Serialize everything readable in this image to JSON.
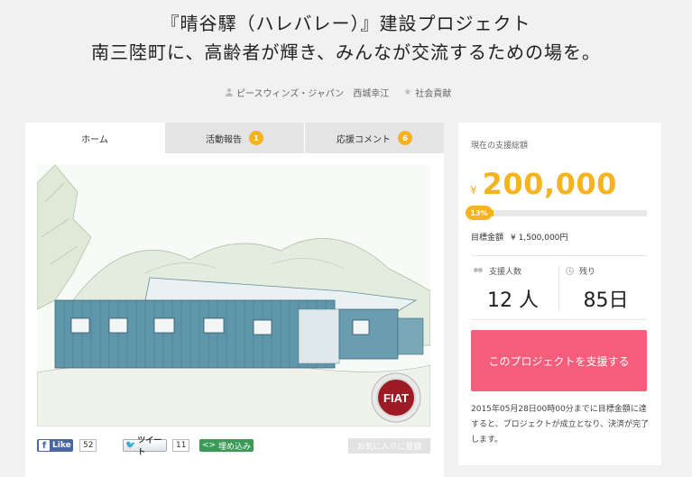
{
  "header": {
    "title": "『晴谷驛（ハレバレー）』建設プロジェクト",
    "subtitle": "南三陸町に、高齢者が輝き、みんなが交流するための場を。",
    "owner": "ピースウィンズ・ジャパン　西城幸江",
    "category": "社会貢献"
  },
  "tabs": [
    {
      "label": "ホーム",
      "badge": ""
    },
    {
      "label": "活動報告",
      "badge": "1"
    },
    {
      "label": "応援コメント",
      "badge": "6"
    }
  ],
  "hero": {
    "logo_text": "FIAT"
  },
  "social": {
    "like_label": "Like",
    "like_count": "52",
    "tweet_label": "ツイート",
    "tweet_count": "11",
    "embed_label": "埋め込み",
    "favorite_label": "お気に入りに登録"
  },
  "funding": {
    "total_label": "現在の支援総額",
    "currency": "¥",
    "amount": "200,000",
    "percent_label": "13%",
    "progress": 0.13,
    "goal_label": "目標金額",
    "goal_value": "¥ 1,500,000円",
    "supporters_label": "支援人数",
    "supporters_value": "12 人",
    "remaining_label": "残り",
    "remaining_value": "85日",
    "support_button": "このプロジェクトを支援する",
    "note": "2015年05月28日00時00分までに目標金額に達すると、プロジェクトが成立となり、決済が完了します。"
  },
  "colors": {
    "accent": "#f5b321",
    "button": "#f55e7b",
    "facebook": "#4a66a0",
    "embed": "#3b9a55"
  }
}
